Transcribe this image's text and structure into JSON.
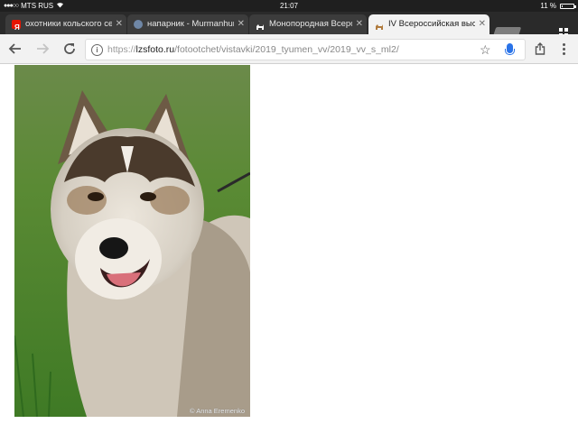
{
  "status_bar": {
    "carrier": "MTS RUS",
    "time": "21:07",
    "battery_text": "11 %",
    "battery_level": 0.11
  },
  "tabs": [
    {
      "title": "охотники кольского се",
      "favicon": "yandex-icon",
      "color": "#e61400",
      "active": false
    },
    {
      "title": "напарник - Murmanhun",
      "favicon": "forum-icon",
      "color": "#6f87a6",
      "active": false
    },
    {
      "title": "Монопородная Всерос",
      "favicon": "dog-icon",
      "color": "#ffffff",
      "active": false
    },
    {
      "title": "IV Всероссийская выс",
      "favicon": "dog-icon",
      "color": "#b07a3c",
      "active": true
    }
  ],
  "toolbar": {
    "url_protocol": "https://",
    "url_host": "lzsfoto.ru",
    "url_path": "/fotootchet/vistavki/2019_tyumen_vv/2019_vv_s_ml2/"
  },
  "content": {
    "image_alt": "photo of a husky dog",
    "watermark": "© Anna Eremenko"
  },
  "colors": {
    "status_bar_bg": "#1f1f1f",
    "tab_strip_bg": "#2a2a2a",
    "active_tab_bg": "#f2f2f2",
    "mic_accent": "#2a73e8"
  }
}
